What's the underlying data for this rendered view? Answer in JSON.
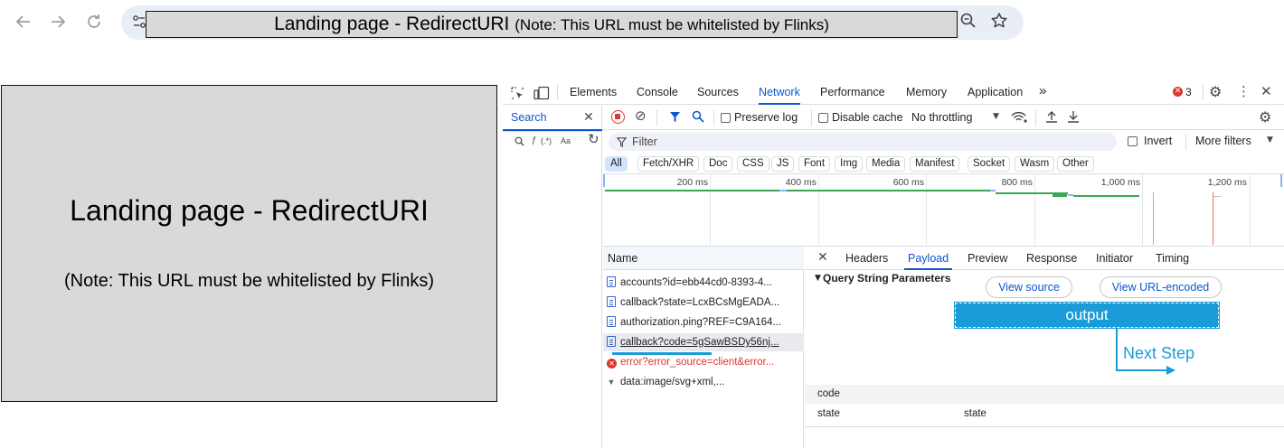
{
  "browser": {
    "back_icon": "back-arrow-icon",
    "forward_icon": "forward-arrow-icon",
    "reload_icon": "reload-icon",
    "url_main": "Landing page - RedirectURI",
    "url_note": "(Note: This URL must be whitelisted by Flinks)"
  },
  "landing": {
    "title": "Landing page - RedirectURI",
    "note": "(Note: This URL must be whitelisted by Flinks)"
  },
  "devtools": {
    "tabs": [
      "Elements",
      "Console",
      "Sources",
      "Network",
      "Performance",
      "Memory",
      "Application"
    ],
    "active_tab": "Network",
    "more_tabs": "»",
    "error_count": "3",
    "search_label": "Search",
    "search_options": {
      "regex": "(.*)",
      "case": "Aa"
    },
    "toolbar": {
      "preserve_log": "Preserve log",
      "disable_cache": "Disable cache",
      "throttling": "No throttling"
    },
    "filter": {
      "placeholder": "Filter",
      "invert": "Invert",
      "more_filters": "More filters"
    },
    "types": [
      "All",
      "Fetch/XHR",
      "Doc",
      "CSS",
      "JS",
      "Font",
      "Img",
      "Media",
      "Manifest",
      "Socket",
      "Wasm",
      "Other"
    ],
    "timeline_ticks": [
      "200 ms",
      "400 ms",
      "600 ms",
      "800 ms",
      "1,000 ms",
      "1,200 ms"
    ],
    "name_header": "Name",
    "requests": [
      {
        "name": "accounts?id=ebb44cd0-8393-4...",
        "kind": "doc"
      },
      {
        "name": "callback?state=LcxBCsMgEADA...",
        "kind": "doc"
      },
      {
        "name": "authorization.ping?REF=C9A164...",
        "kind": "doc"
      },
      {
        "name": "callback?code=5gSawBSDy56nj...",
        "kind": "doc",
        "selected": true
      },
      {
        "name": "error?error_source=client&error...",
        "kind": "error"
      },
      {
        "name": "data:image/svg+xml,...",
        "kind": "data"
      }
    ],
    "detail_tabs": [
      "Headers",
      "Payload",
      "Preview",
      "Response",
      "Initiator",
      "Timing"
    ],
    "detail_active": "Payload",
    "section_title": "Query String Parameters",
    "view_source": "View source",
    "view_url_encoded": "View URL-encoded",
    "params": [
      {
        "key": "code",
        "value": ""
      },
      {
        "key": "state",
        "value": "state"
      }
    ]
  },
  "annotations": {
    "output": "output",
    "next_step": "Next Step",
    "color": "#1a9cd8"
  }
}
